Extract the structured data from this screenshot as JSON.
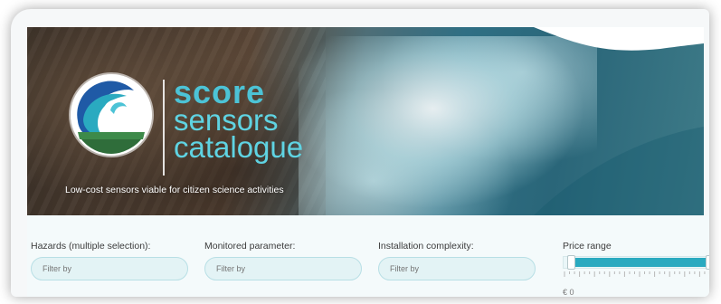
{
  "banner": {
    "logo": {
      "word1": "score",
      "word2": "sensors",
      "word3": "catalogue"
    },
    "tagline": "Low-cost sensors viable for citizen science activities"
  },
  "filters": {
    "hazards": {
      "label": "Hazards (multiple selection):",
      "placeholder": "Filter by"
    },
    "parameter": {
      "label": "Monitored parameter:",
      "placeholder": "Filter by"
    },
    "complexity": {
      "label": "Installation complexity:",
      "placeholder": "Filter by"
    }
  },
  "price": {
    "label": "Price range",
    "min_label": "€ 0",
    "max_label": "€",
    "selected_fraction_low": 0.0,
    "selected_fraction_high": 1.0
  },
  "colors": {
    "accent": "#2aaac0",
    "logo_text": "#4cc3d6",
    "input_bg": "#e3f3f5"
  }
}
